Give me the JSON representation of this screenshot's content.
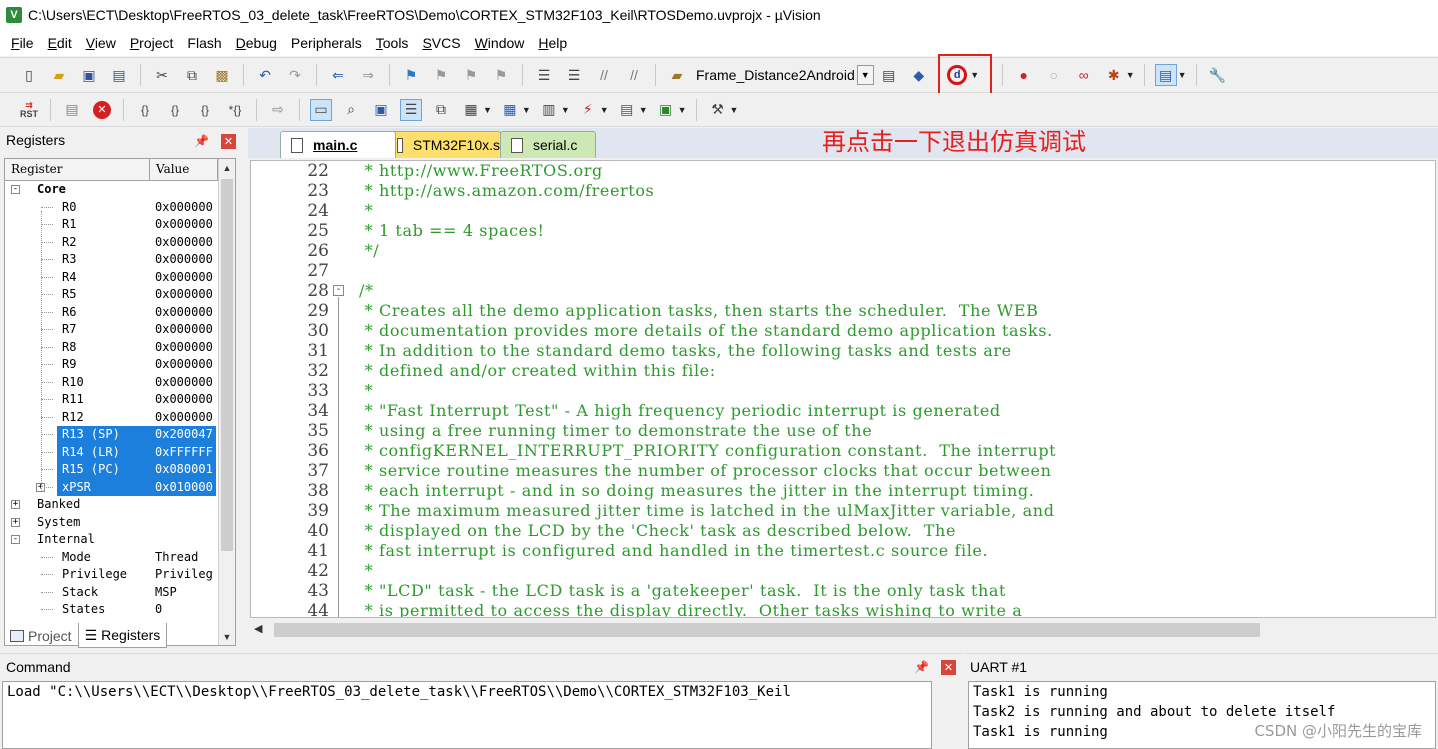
{
  "window": {
    "title": "C:\\Users\\ECT\\Desktop\\FreeRTOS_03_delete_task\\FreeRTOS\\Demo\\CORTEX_STM32F103_Keil\\RTOSDemo.uvprojx - µVision",
    "app_icon_letter": "V"
  },
  "menu": [
    {
      "ul": "F",
      "rest": "ile"
    },
    {
      "ul": "E",
      "rest": "dit"
    },
    {
      "ul": "V",
      "rest": "iew"
    },
    {
      "ul": "P",
      "rest": "roject"
    },
    {
      "ul": "",
      "rest": "Flash"
    },
    {
      "ul": "D",
      "rest": "ebug"
    },
    {
      "ul": "",
      "rest": "Peripherals"
    },
    {
      "ul": "T",
      "rest": "ools"
    },
    {
      "ul": "S",
      "rest": "VCS"
    },
    {
      "ul": "W",
      "rest": "indow"
    },
    {
      "ul": "H",
      "rest": "elp"
    }
  ],
  "toolbar": {
    "target_name": "Frame_Distance2Android",
    "reset_label": "RST"
  },
  "registers": {
    "panel_title": "Registers",
    "col_register": "Register",
    "col_value": "Value",
    "rows": [
      {
        "name": "Core",
        "value": "",
        "bold": true
      },
      {
        "name": "R0",
        "value": "0x000000"
      },
      {
        "name": "R1",
        "value": "0x000000"
      },
      {
        "name": "R2",
        "value": "0x000000"
      },
      {
        "name": "R3",
        "value": "0x000000"
      },
      {
        "name": "R4",
        "value": "0x000000"
      },
      {
        "name": "R5",
        "value": "0x000000"
      },
      {
        "name": "R6",
        "value": "0x000000"
      },
      {
        "name": "R7",
        "value": "0x000000"
      },
      {
        "name": "R8",
        "value": "0x000000"
      },
      {
        "name": "R9",
        "value": "0x000000"
      },
      {
        "name": "R10",
        "value": "0x000000"
      },
      {
        "name": "R11",
        "value": "0x000000"
      },
      {
        "name": "R12",
        "value": "0x000000"
      },
      {
        "name": "R13 (SP)",
        "value": "0x200047"
      },
      {
        "name": "R14 (LR)",
        "value": "0xFFFFFF"
      },
      {
        "name": "R15 (PC)",
        "value": "0x080001"
      },
      {
        "name": "xPSR",
        "value": "0x010000"
      },
      {
        "name": "Banked",
        "value": ""
      },
      {
        "name": "System",
        "value": ""
      },
      {
        "name": "Internal",
        "value": ""
      },
      {
        "name": "Mode",
        "value": "Thread"
      },
      {
        "name": "Privilege",
        "value": "Privileg"
      },
      {
        "name": "Stack",
        "value": "MSP"
      },
      {
        "name": "States",
        "value": "0"
      }
    ],
    "tabs": [
      "Project",
      "Registers"
    ]
  },
  "editor": {
    "tabs": [
      "main.c",
      "STM32F10x.s",
      "serial.c"
    ],
    "annotation": "再点击一下退出仿真调试",
    "lines": [
      {
        "n": "22",
        "t": " * http://www.FreeRTOS.org"
      },
      {
        "n": "23",
        "t": " * http://aws.amazon.com/freertos"
      },
      {
        "n": "24",
        "t": " *"
      },
      {
        "n": "25",
        "t": " * 1 tab == 4 spaces!"
      },
      {
        "n": "26",
        "t": " */"
      },
      {
        "n": "27",
        "t": ""
      },
      {
        "n": "28",
        "t": "/*"
      },
      {
        "n": "29",
        "t": " * Creates all the demo application tasks, then starts the scheduler.  The WEB"
      },
      {
        "n": "30",
        "t": " * documentation provides more details of the standard demo application tasks."
      },
      {
        "n": "31",
        "t": " * In addition to the standard demo tasks, the following tasks and tests are"
      },
      {
        "n": "32",
        "t": " * defined and/or created within this file:"
      },
      {
        "n": "33",
        "t": " *"
      },
      {
        "n": "34",
        "t": " * \"Fast Interrupt Test\" - A high frequency periodic interrupt is generated"
      },
      {
        "n": "35",
        "t": " * using a free running timer to demonstrate the use of the"
      },
      {
        "n": "36",
        "t": " * configKERNEL_INTERRUPT_PRIORITY configuration constant.  The interrupt"
      },
      {
        "n": "37",
        "t": " * service routine measures the number of processor clocks that occur between"
      },
      {
        "n": "38",
        "t": " * each interrupt - and in so doing measures the jitter in the interrupt timing."
      },
      {
        "n": "39",
        "t": " * The maximum measured jitter time is latched in the ulMaxJitter variable, and"
      },
      {
        "n": "40",
        "t": " * displayed on the LCD by the 'Check' task as described below.  The"
      },
      {
        "n": "41",
        "t": " * fast interrupt is configured and handled in the timertest.c source file."
      },
      {
        "n": "42",
        "t": " *"
      },
      {
        "n": "43",
        "t": " * \"LCD\" task - the LCD task is a 'gatekeeper' task.  It is the only task that"
      },
      {
        "n": "44",
        "t": " * is permitted to access the display directly.  Other tasks wishing to write a"
      }
    ]
  },
  "command": {
    "title": "Command",
    "lines": [
      "Load \"C:\\\\Users\\\\ECT\\\\Desktop\\\\FreeRTOS_03_delete_task\\\\FreeRTOS\\\\Demo\\\\CORTEX_STM32F103_Keil"
    ]
  },
  "uart": {
    "title": "UART #1",
    "lines": [
      "Task1 is running",
      "Task2 is running and about to delete itself",
      "Task1 is running"
    ]
  },
  "watermark": "CSDN @小阳先生的宝库",
  "colors": {
    "accent_selection": "#1c7fdb",
    "code_comment": "#2e9a2e",
    "annotation_red": "#e8201c"
  }
}
